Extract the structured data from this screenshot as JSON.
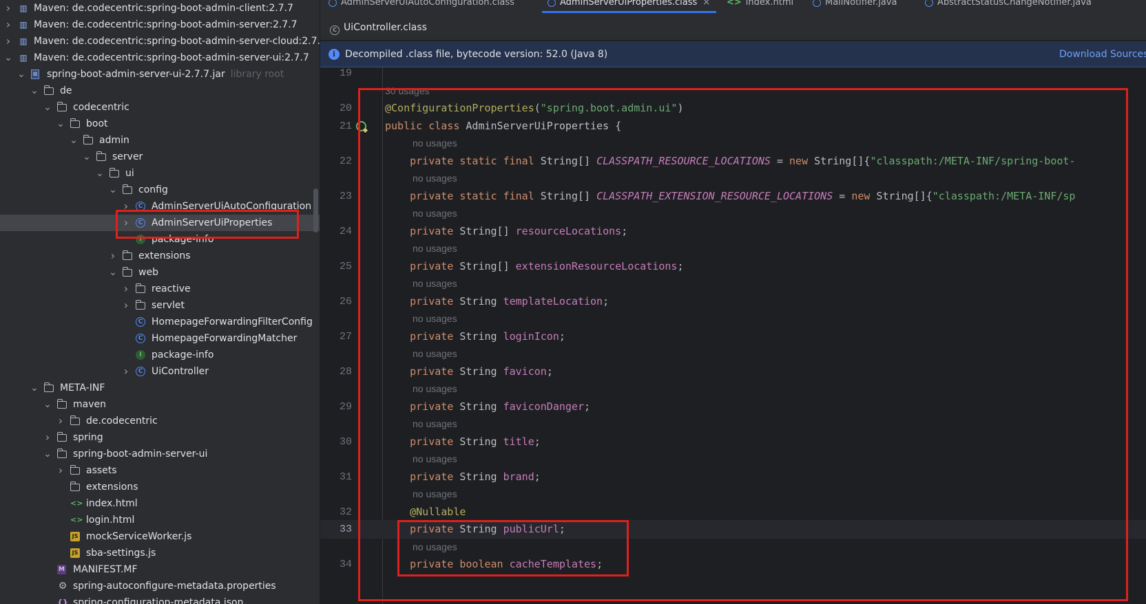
{
  "project_tree": {
    "rows": [
      {
        "label": "Maven: de.codecentric:spring-boot-admin-client:2.7.7",
        "icon": "maven-library-icon",
        "expanded": false
      },
      {
        "label": "Maven: de.codecentric:spring-boot-admin-server:2.7.7",
        "icon": "maven-library-icon",
        "expanded": false
      },
      {
        "label": "Maven: de.codecentric:spring-boot-admin-server-cloud:2.7.7",
        "icon": "maven-library-icon",
        "expanded": false
      },
      {
        "label": "Maven: de.codecentric:spring-boot-admin-server-ui:2.7.7",
        "icon": "maven-library-icon",
        "expanded": true
      },
      {
        "label": "spring-boot-admin-server-ui-2.7.7.jar",
        "hint": "library root",
        "icon": "jar-icon",
        "expanded": true
      },
      {
        "label": "de",
        "icon": "folder-icon",
        "expanded": true
      },
      {
        "label": "codecentric",
        "icon": "folder-icon",
        "expanded": true
      },
      {
        "label": "boot",
        "icon": "folder-icon",
        "expanded": true
      },
      {
        "label": "admin",
        "icon": "folder-icon",
        "expanded": true
      },
      {
        "label": "server",
        "icon": "folder-icon",
        "expanded": true
      },
      {
        "label": "ui",
        "icon": "folder-icon",
        "expanded": true
      },
      {
        "label": "config",
        "icon": "folder-icon",
        "expanded": true
      },
      {
        "label": "AdminServerUiAutoConfiguration",
        "icon": "class-icon",
        "expanded": false
      },
      {
        "label": "AdminServerUiProperties",
        "icon": "class-icon",
        "expanded": false,
        "selected": true
      },
      {
        "label": "package-info",
        "icon": "info-icon"
      },
      {
        "label": "extensions",
        "icon": "folder-icon",
        "expanded": false
      },
      {
        "label": "web",
        "icon": "folder-icon",
        "expanded": true
      },
      {
        "label": "reactive",
        "icon": "folder-icon",
        "expanded": false
      },
      {
        "label": "servlet",
        "icon": "folder-icon",
        "expanded": false
      },
      {
        "label": "HomepageForwardingFilterConfig",
        "icon": "class-icon"
      },
      {
        "label": "HomepageForwardingMatcher",
        "icon": "class-icon"
      },
      {
        "label": "package-info",
        "icon": "info-icon"
      },
      {
        "label": "UiController",
        "icon": "class-icon",
        "expanded": false
      },
      {
        "label": "META-INF",
        "icon": "folder-icon",
        "expanded": true
      },
      {
        "label": "maven",
        "icon": "folder-icon",
        "expanded": true
      },
      {
        "label": "de.codecentric",
        "icon": "folder-icon",
        "expanded": false
      },
      {
        "label": "spring",
        "icon": "folder-icon",
        "expanded": false
      },
      {
        "label": "spring-boot-admin-server-ui",
        "icon": "folder-icon",
        "expanded": true
      },
      {
        "label": "assets",
        "icon": "folder-icon",
        "expanded": false
      },
      {
        "label": "extensions",
        "icon": "folder-icon"
      },
      {
        "label": "index.html",
        "icon": "html-file-icon"
      },
      {
        "label": "login.html",
        "icon": "html-file-icon"
      },
      {
        "label": "mockServiceWorker.js",
        "icon": "js-file-icon"
      },
      {
        "label": "sba-settings.js",
        "icon": "js-file-icon"
      },
      {
        "label": "MANIFEST.MF",
        "icon": "manifest-file-icon"
      },
      {
        "label": "spring-autoconfigure-metadata.properties",
        "icon": "properties-file-icon"
      },
      {
        "label": "spring-configuration-metadata.json",
        "icon": "json-file-icon"
      }
    ]
  },
  "editor": {
    "tabs_row1": [
      "AdminServerUiAutoConfiguration.class",
      "AdminServerUiProperties.class",
      "index.html",
      "MailNotifier.java",
      "AbstractStatusChangeNotifier.java"
    ],
    "tabs_row2": [
      "UiController.class"
    ],
    "banner": {
      "message": "Decompiled .class file, bytecode version: 52.0 (Java 8)",
      "link": "Download Sources"
    }
  },
  "code_lines": [
    {
      "n": "19",
      "hint": null
    },
    {
      "n": null,
      "hint": "30 usages"
    },
    {
      "n": "20",
      "code": [
        [
          "ann",
          "@ConfigurationProperties"
        ],
        [
          "",
          "("
        ],
        [
          "str",
          "\"spring.boot.admin.ui\""
        ],
        [
          "",
          ")"
        ]
      ]
    },
    {
      "n": "21",
      "code": [
        [
          "kw",
          "public class "
        ],
        [
          "",
          "AdminServerUiProperties {"
        ]
      ],
      "marker": true
    },
    {
      "n": null,
      "hint": "no usages"
    },
    {
      "n": "22",
      "code": [
        [
          "kw",
          "    private static final "
        ],
        [
          "",
          "String[] "
        ],
        [
          "cst",
          "CLASSPATH_RESOURCE_LOCATIONS"
        ],
        [
          "",
          " = "
        ],
        [
          "kw",
          "new "
        ],
        [
          "",
          "String[]{"
        ],
        [
          "str",
          "\"classpath:/META-INF/spring-boot-"
        ]
      ]
    },
    {
      "n": null,
      "hint": "no usages"
    },
    {
      "n": "23",
      "code": [
        [
          "kw",
          "    private static final "
        ],
        [
          "",
          "String[] "
        ],
        [
          "cst",
          "CLASSPATH_EXTENSION_RESOURCE_LOCATIONS"
        ],
        [
          "",
          " = "
        ],
        [
          "kw",
          "new "
        ],
        [
          "",
          "String[]{"
        ],
        [
          "str",
          "\"classpath:/META-INF/sp"
        ]
      ]
    },
    {
      "n": null,
      "hint": "no usages"
    },
    {
      "n": "24",
      "code": [
        [
          "kw",
          "    private "
        ],
        [
          "",
          "String[] "
        ],
        [
          "fld",
          "resourceLocations"
        ],
        [
          "",
          ";"
        ]
      ]
    },
    {
      "n": null,
      "hint": "no usages"
    },
    {
      "n": "25",
      "code": [
        [
          "kw",
          "    private "
        ],
        [
          "",
          "String[] "
        ],
        [
          "fld",
          "extensionResourceLocations"
        ],
        [
          "",
          ";"
        ]
      ]
    },
    {
      "n": null,
      "hint": "no usages"
    },
    {
      "n": "26",
      "code": [
        [
          "kw",
          "    private "
        ],
        [
          "",
          "String "
        ],
        [
          "fld",
          "templateLocation"
        ],
        [
          "",
          ";"
        ]
      ]
    },
    {
      "n": null,
      "hint": "no usages"
    },
    {
      "n": "27",
      "code": [
        [
          "kw",
          "    private "
        ],
        [
          "",
          "String "
        ],
        [
          "fld",
          "loginIcon"
        ],
        [
          "",
          ";"
        ]
      ]
    },
    {
      "n": null,
      "hint": "no usages"
    },
    {
      "n": "28",
      "code": [
        [
          "kw",
          "    private "
        ],
        [
          "",
          "String "
        ],
        [
          "fld",
          "favicon"
        ],
        [
          "",
          ";"
        ]
      ]
    },
    {
      "n": null,
      "hint": "no usages"
    },
    {
      "n": "29",
      "code": [
        [
          "kw",
          "    private "
        ],
        [
          "",
          "String "
        ],
        [
          "fld",
          "faviconDanger"
        ],
        [
          "",
          ";"
        ]
      ]
    },
    {
      "n": null,
      "hint": "no usages"
    },
    {
      "n": "30",
      "code": [
        [
          "kw",
          "    private "
        ],
        [
          "",
          "String "
        ],
        [
          "fld",
          "title"
        ],
        [
          "",
          ";"
        ]
      ]
    },
    {
      "n": null,
      "hint": "no usages"
    },
    {
      "n": "31",
      "code": [
        [
          "kw",
          "    private "
        ],
        [
          "",
          "String "
        ],
        [
          "fld",
          "brand"
        ],
        [
          "",
          ";"
        ]
      ]
    },
    {
      "n": null,
      "hint": "no usages"
    },
    {
      "n": "32",
      "code": [
        [
          "ann",
          "    @Nullable"
        ]
      ]
    },
    {
      "n": "33",
      "code": [
        [
          "kw",
          "    private "
        ],
        [
          "",
          "String "
        ],
        [
          "fld",
          "publicUrl"
        ],
        [
          "",
          ";"
        ]
      ],
      "current": true
    },
    {
      "n": null,
      "hint": "no usages"
    },
    {
      "n": "34",
      "code": [
        [
          "kw",
          "    private boolean "
        ],
        [
          "fld",
          "cacheTemplates"
        ],
        [
          "",
          ";"
        ]
      ]
    }
  ]
}
